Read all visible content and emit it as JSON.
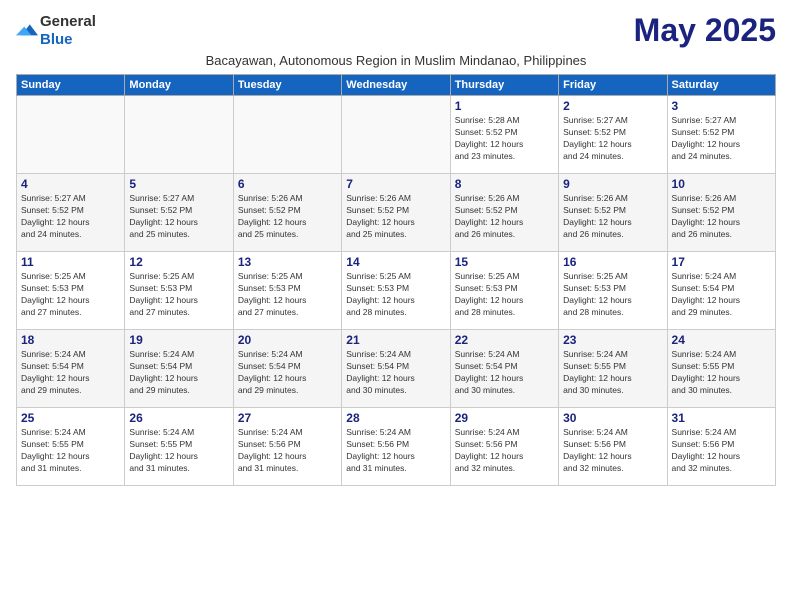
{
  "logo": {
    "general": "General",
    "blue": "Blue"
  },
  "title": "May 2025",
  "location": "Bacayawan, Autonomous Region in Muslim Mindanao, Philippines",
  "weekdays": [
    "Sunday",
    "Monday",
    "Tuesday",
    "Wednesday",
    "Thursday",
    "Friday",
    "Saturday"
  ],
  "weeks": [
    [
      {
        "day": "",
        "info": ""
      },
      {
        "day": "",
        "info": ""
      },
      {
        "day": "",
        "info": ""
      },
      {
        "day": "",
        "info": ""
      },
      {
        "day": "1",
        "info": "Sunrise: 5:28 AM\nSunset: 5:52 PM\nDaylight: 12 hours\nand 23 minutes."
      },
      {
        "day": "2",
        "info": "Sunrise: 5:27 AM\nSunset: 5:52 PM\nDaylight: 12 hours\nand 24 minutes."
      },
      {
        "day": "3",
        "info": "Sunrise: 5:27 AM\nSunset: 5:52 PM\nDaylight: 12 hours\nand 24 minutes."
      }
    ],
    [
      {
        "day": "4",
        "info": "Sunrise: 5:27 AM\nSunset: 5:52 PM\nDaylight: 12 hours\nand 24 minutes."
      },
      {
        "day": "5",
        "info": "Sunrise: 5:27 AM\nSunset: 5:52 PM\nDaylight: 12 hours\nand 25 minutes."
      },
      {
        "day": "6",
        "info": "Sunrise: 5:26 AM\nSunset: 5:52 PM\nDaylight: 12 hours\nand 25 minutes."
      },
      {
        "day": "7",
        "info": "Sunrise: 5:26 AM\nSunset: 5:52 PM\nDaylight: 12 hours\nand 25 minutes."
      },
      {
        "day": "8",
        "info": "Sunrise: 5:26 AM\nSunset: 5:52 PM\nDaylight: 12 hours\nand 26 minutes."
      },
      {
        "day": "9",
        "info": "Sunrise: 5:26 AM\nSunset: 5:52 PM\nDaylight: 12 hours\nand 26 minutes."
      },
      {
        "day": "10",
        "info": "Sunrise: 5:26 AM\nSunset: 5:52 PM\nDaylight: 12 hours\nand 26 minutes."
      }
    ],
    [
      {
        "day": "11",
        "info": "Sunrise: 5:25 AM\nSunset: 5:53 PM\nDaylight: 12 hours\nand 27 minutes."
      },
      {
        "day": "12",
        "info": "Sunrise: 5:25 AM\nSunset: 5:53 PM\nDaylight: 12 hours\nand 27 minutes."
      },
      {
        "day": "13",
        "info": "Sunrise: 5:25 AM\nSunset: 5:53 PM\nDaylight: 12 hours\nand 27 minutes."
      },
      {
        "day": "14",
        "info": "Sunrise: 5:25 AM\nSunset: 5:53 PM\nDaylight: 12 hours\nand 28 minutes."
      },
      {
        "day": "15",
        "info": "Sunrise: 5:25 AM\nSunset: 5:53 PM\nDaylight: 12 hours\nand 28 minutes."
      },
      {
        "day": "16",
        "info": "Sunrise: 5:25 AM\nSunset: 5:53 PM\nDaylight: 12 hours\nand 28 minutes."
      },
      {
        "day": "17",
        "info": "Sunrise: 5:24 AM\nSunset: 5:54 PM\nDaylight: 12 hours\nand 29 minutes."
      }
    ],
    [
      {
        "day": "18",
        "info": "Sunrise: 5:24 AM\nSunset: 5:54 PM\nDaylight: 12 hours\nand 29 minutes."
      },
      {
        "day": "19",
        "info": "Sunrise: 5:24 AM\nSunset: 5:54 PM\nDaylight: 12 hours\nand 29 minutes."
      },
      {
        "day": "20",
        "info": "Sunrise: 5:24 AM\nSunset: 5:54 PM\nDaylight: 12 hours\nand 29 minutes."
      },
      {
        "day": "21",
        "info": "Sunrise: 5:24 AM\nSunset: 5:54 PM\nDaylight: 12 hours\nand 30 minutes."
      },
      {
        "day": "22",
        "info": "Sunrise: 5:24 AM\nSunset: 5:54 PM\nDaylight: 12 hours\nand 30 minutes."
      },
      {
        "day": "23",
        "info": "Sunrise: 5:24 AM\nSunset: 5:55 PM\nDaylight: 12 hours\nand 30 minutes."
      },
      {
        "day": "24",
        "info": "Sunrise: 5:24 AM\nSunset: 5:55 PM\nDaylight: 12 hours\nand 30 minutes."
      }
    ],
    [
      {
        "day": "25",
        "info": "Sunrise: 5:24 AM\nSunset: 5:55 PM\nDaylight: 12 hours\nand 31 minutes."
      },
      {
        "day": "26",
        "info": "Sunrise: 5:24 AM\nSunset: 5:55 PM\nDaylight: 12 hours\nand 31 minutes."
      },
      {
        "day": "27",
        "info": "Sunrise: 5:24 AM\nSunset: 5:56 PM\nDaylight: 12 hours\nand 31 minutes."
      },
      {
        "day": "28",
        "info": "Sunrise: 5:24 AM\nSunset: 5:56 PM\nDaylight: 12 hours\nand 31 minutes."
      },
      {
        "day": "29",
        "info": "Sunrise: 5:24 AM\nSunset: 5:56 PM\nDaylight: 12 hours\nand 32 minutes."
      },
      {
        "day": "30",
        "info": "Sunrise: 5:24 AM\nSunset: 5:56 PM\nDaylight: 12 hours\nand 32 minutes."
      },
      {
        "day": "31",
        "info": "Sunrise: 5:24 AM\nSunset: 5:56 PM\nDaylight: 12 hours\nand 32 minutes."
      }
    ]
  ]
}
